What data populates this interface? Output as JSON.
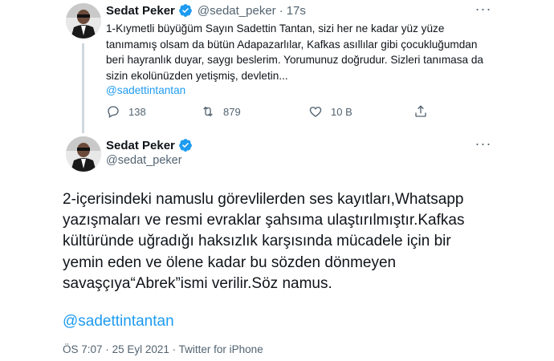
{
  "accent_color": "#1d9bf0",
  "verified_color": "#1d9bf0",
  "tweet1": {
    "name": "Sedat Peker",
    "handle": "@sedat_peker",
    "separator": "·",
    "time": "17s",
    "more_icon": "more-horizontal-icon",
    "text": "1-Kıymetli büyüğüm Sayın Sadettin Tantan, sizi her ne kadar yüz yüze tanımamış olsam da bütün Adapazarlılar, Kafkas asıllılar gibi çocukluğumdan beri hayranlık duyar, saygı beslerim. Yorumunuz doğrudur. Sizleri tanımasa da sizin ekolünüzden yetişmiş, devletin...",
    "mention": "@sadettintantan",
    "replies": "138",
    "retweets": "879",
    "likes": "10 B"
  },
  "tweet2": {
    "name": "Sedat Peker",
    "handle": "@sedat_peker",
    "text": "2-içerisindeki namuslu görevlilerden ses kayıtları,Whatsapp yazışmaları ve resmi evraklar şahsıma ulaştırılmıştır.Kafkas kültüründe uğradığı haksızlık karşısında mücadele için bir yemin eden ve ölene kadar bu sözden dönmeyen savaşçıya“Abrek”ismi verilir.Söz namus.",
    "mention": "@sadettintantan",
    "time": "ÖS 7:07",
    "date": "25 Eyl 2021",
    "source": "Twitter for iPhone",
    "separator": "·"
  }
}
